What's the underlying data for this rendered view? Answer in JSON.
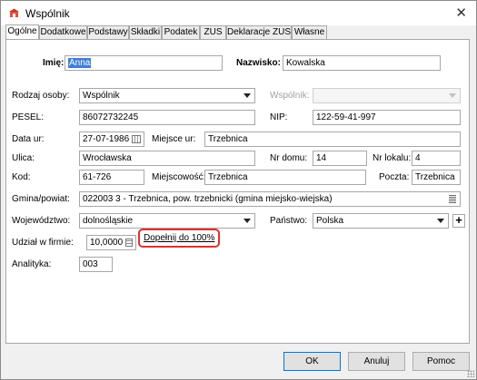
{
  "window": {
    "title": "Wspólnik",
    "close_glyph": "✕",
    "app_icon": "partner-app-icon"
  },
  "tabs": [
    {
      "label": "Ogólne",
      "active": true
    },
    {
      "label": "Dodatkowe",
      "active": false
    },
    {
      "label": "Podstawy",
      "active": false
    },
    {
      "label": "Składki",
      "active": false
    },
    {
      "label": "Podatek",
      "active": false
    },
    {
      "label": "ZUS",
      "active": false
    },
    {
      "label": "Deklaracje ZUS",
      "active": false
    },
    {
      "label": "Własne",
      "active": false
    }
  ],
  "form": {
    "imie": {
      "label": "Imię:",
      "value": "Anna"
    },
    "nazwisko": {
      "label": "Nazwisko:",
      "value": "Kowalska"
    },
    "rodzaj_osoby": {
      "label": "Rodzaj osoby:",
      "value": "Wspólnik"
    },
    "wspolnik": {
      "label": "Wspólnik:",
      "value": ""
    },
    "pesel": {
      "label": "PESEL:",
      "value": "86072732245"
    },
    "nip": {
      "label": "NIP:",
      "value": "122-59-41-997"
    },
    "data_ur": {
      "label": "Data ur:",
      "value": "27-07-1986"
    },
    "miejsce_ur": {
      "label": "Miejsce ur:",
      "value": "Trzebnica"
    },
    "ulica": {
      "label": "Ulica:",
      "value": "Wrocławska"
    },
    "nr_domu": {
      "label": "Nr domu:",
      "value": "14"
    },
    "nr_lokalu": {
      "label": "Nr lokalu:",
      "value": "4"
    },
    "kod": {
      "label": "Kod:",
      "value": "61-726"
    },
    "miejscowosc": {
      "label": "Miejscowość:",
      "value": "Trzebnica"
    },
    "poczta": {
      "label": "Poczta:",
      "value": "Trzebnica"
    },
    "gmina": {
      "label": "Gmina/powiat:",
      "value": "022003 3 - Trzebnica, pow. trzebnicki (gmina miejsko-wiejska)"
    },
    "wojewodztwo": {
      "label": "Województwo:",
      "value": "dolnośląskie"
    },
    "panstwo": {
      "label": "Państwo:",
      "value": "Polska",
      "add_glyph": "+"
    },
    "udzial": {
      "label": "Udział w firmie:",
      "value": "10,0000",
      "fill_link": "Dopełnij do 100%"
    },
    "analityka": {
      "label": "Analityka:",
      "value": "003"
    }
  },
  "buttons": {
    "ok": "OK",
    "cancel": "Anuluj",
    "help": "Pomoc"
  },
  "colors": {
    "selection": "#3d7fd6",
    "highlight_border": "#e03030",
    "default_button_border": "#0078d7"
  }
}
